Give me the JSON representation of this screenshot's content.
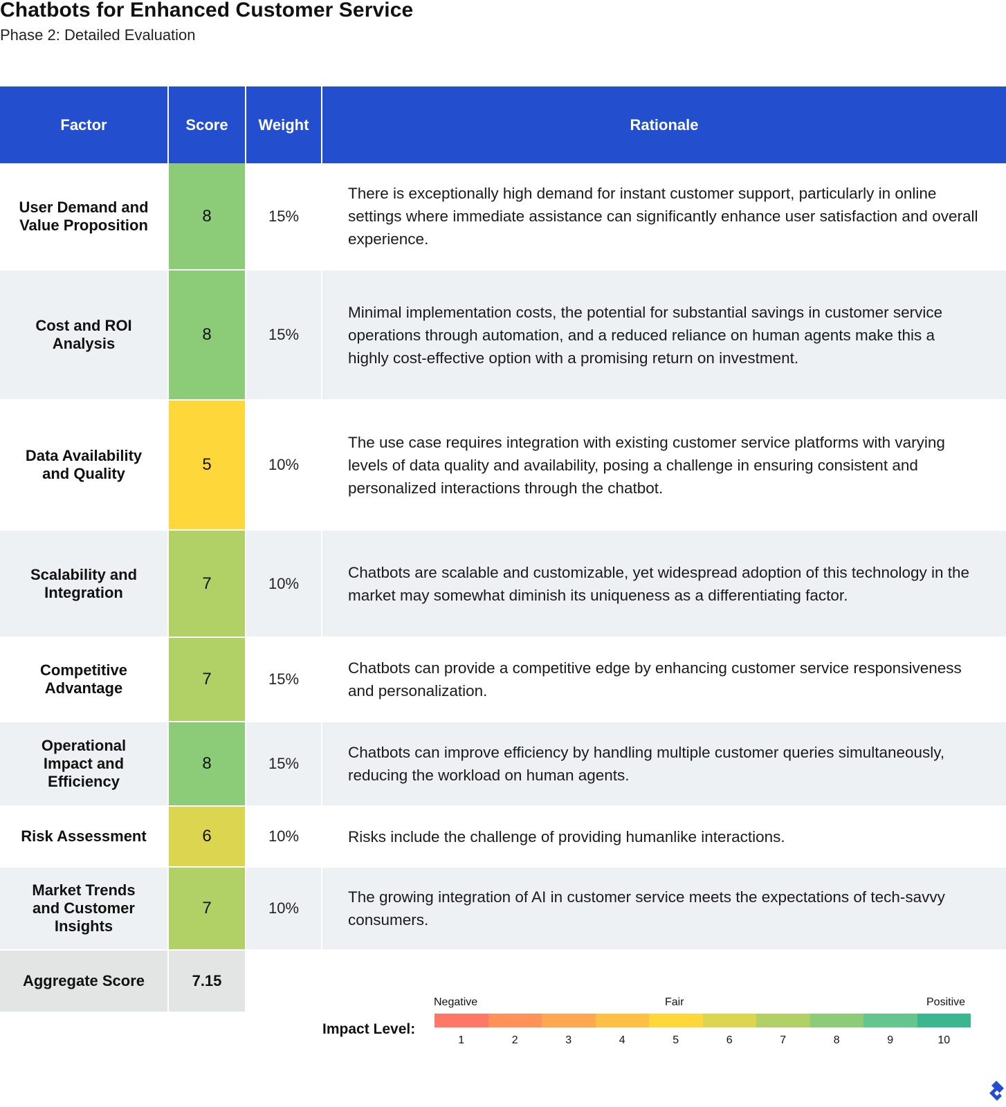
{
  "header": {
    "title": "Chatbots for Enhanced Customer Service",
    "subtitle": "Phase 2: Detailed Evaluation"
  },
  "table": {
    "columns": [
      "Factor",
      "Score",
      "Weight",
      "Rationale"
    ],
    "rows": [
      {
        "factor": "User Demand and Value Proposition",
        "score": "8",
        "weight": "15%",
        "rationale": "There is exceptionally high demand for instant customer support, particularly in online settings where immediate assistance can significantly enhance user satisfaction and overall experience.",
        "score_color": "#8ccc78"
      },
      {
        "factor": "Cost and ROI Analysis",
        "score": "8",
        "weight": "15%",
        "rationale": "Minimal implementation costs, the potential for substantial savings in customer service operations through automation, and a reduced reliance on human agents make this a highly cost-effective option with a promising return on investment.",
        "score_color": "#8ccc78"
      },
      {
        "factor": "Data Availability and Quality",
        "score": "5",
        "weight": "10%",
        "rationale": "The use case requires integration with existing customer service platforms with varying levels of data quality and availability, posing a challenge in ensuring consistent and personalized interactions through the chatbot.",
        "score_color": "#fed83a"
      },
      {
        "factor": "Scalability and Integration",
        "score": "7",
        "weight": "10%",
        "rationale": "Chatbots are scalable and customizable, yet widespread adoption of this technology in the market may somewhat diminish its uniqueness as a differentiating factor.",
        "score_color": "#b1d166"
      },
      {
        "factor": "Competitive Advantage",
        "score": "7",
        "weight": "15%",
        "rationale": "Chatbots can provide a competitive edge by enhancing customer service responsiveness and personalization.",
        "score_color": "#b1d166"
      },
      {
        "factor": "Operational Impact and Efficiency",
        "score": "8",
        "weight": "15%",
        "rationale": "Chatbots can improve efficiency by handling multiple customer queries simultaneously, reducing the workload on human agents.",
        "score_color": "#8ccc78"
      },
      {
        "factor": "Risk Assessment",
        "score": "6",
        "weight": "10%",
        "rationale": "Risks include the challenge of providing humanlike interactions.",
        "score_color": "#dbd550"
      },
      {
        "factor": "Market Trends and Customer Insights",
        "score": "7",
        "weight": "10%",
        "rationale": "The growing integration of AI in customer service meets the expectations of tech-savvy consumers.",
        "score_color": "#b1d166"
      }
    ],
    "aggregate": {
      "label": "Aggregate Score",
      "score": "7.15"
    }
  },
  "legend": {
    "title": "Impact Level:",
    "negative_label": "Negative",
    "fair_label": "Fair",
    "positive_label": "Positive",
    "levels": [
      "1",
      "2",
      "3",
      "4",
      "5",
      "6",
      "7",
      "8",
      "9",
      "10"
    ],
    "colors": [
      "#ff7766",
      "#ff9159",
      "#ffa850",
      "#ffc045",
      "#fed83a",
      "#dbd550",
      "#b1d166",
      "#8ccc78",
      "#63c68c",
      "#3bb78f"
    ]
  },
  "colors": {
    "header_bg": "#234fce",
    "stripe_bg": "#eef1f4",
    "aggregate_bg": "#e3e4e4"
  },
  "brand": {
    "logo_icon": "toptal-logo-icon"
  }
}
